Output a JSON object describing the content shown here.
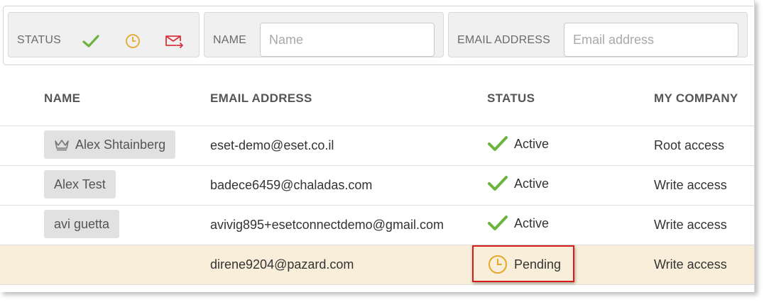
{
  "filters": {
    "status_label": "STATUS",
    "status_icons": [
      "check-icon",
      "clock-icon",
      "mail-sent-icon"
    ],
    "name_label": "NAME",
    "name_placeholder": "Name",
    "email_label": "EMAIL ADDRESS",
    "email_placeholder": "Email address"
  },
  "table": {
    "columns": [
      "NAME",
      "EMAIL ADDRESS",
      "STATUS",
      "MY COMPANY"
    ],
    "rows": [
      {
        "name": "Alex Shtainberg",
        "is_owner": true,
        "email": "eset-demo@eset.co.il",
        "status": "Active",
        "status_icon": "check-icon",
        "access": "Root access"
      },
      {
        "name": "Alex Test",
        "email": "badece6459@chaladas.com",
        "status": "Active",
        "status_icon": "check-icon",
        "access": "Write access"
      },
      {
        "name": "avi guetta",
        "email": "avivig895+esetconnectdemo@gmail.com",
        "status": "Active",
        "status_icon": "check-icon",
        "access": "Write access"
      },
      {
        "name": "",
        "email": "direne9204@pazard.com",
        "status": "Pending",
        "status_icon": "clock-icon",
        "access": "Write access"
      }
    ]
  },
  "colors": {
    "check_green": "#6cb33f",
    "clock_orange": "#e5a82b",
    "mail_red": "#d9343f",
    "pending_row_bg": "#f9eed9",
    "highlight_red": "#d81b1b"
  }
}
